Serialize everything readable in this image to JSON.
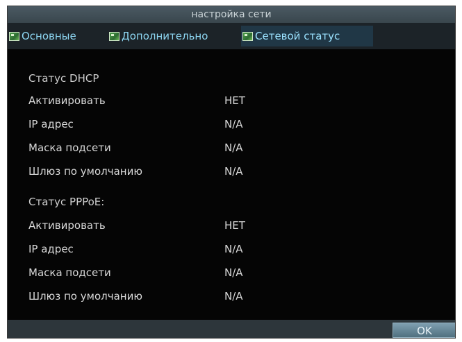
{
  "window": {
    "title": "настройка сети"
  },
  "tabs": [
    {
      "label": "Основные",
      "active": false
    },
    {
      "label": "Дополнительно",
      "active": false
    },
    {
      "label": "Сетевой статус",
      "active": true
    }
  ],
  "dhcp": {
    "title": "Статус DHCP",
    "rows": [
      {
        "label": "Активировать",
        "value": "НЕТ"
      },
      {
        "label": "IP адрес",
        "value": "N/A"
      },
      {
        "label": "Маска подсети",
        "value": "N/A"
      },
      {
        "label": "Шлюз по умолчанию",
        "value": "N/A"
      }
    ]
  },
  "pppoe": {
    "title": "Статус PPPoE:",
    "rows": [
      {
        "label": "Активировать",
        "value": "НЕТ"
      },
      {
        "label": "IP адрес",
        "value": "N/A"
      },
      {
        "label": "Маска подсети",
        "value": "N/A"
      },
      {
        "label": "Шлюз по умолчанию",
        "value": "N/A"
      }
    ]
  },
  "buttons": {
    "ok_label": "OK"
  },
  "colors": {
    "background": "#050505",
    "title_bar": "#4b5a63",
    "tab_text": "#8dd6f2",
    "active_tab": "#203746",
    "text": "#d9d9d9",
    "ok_button": "#6d8fa0"
  }
}
